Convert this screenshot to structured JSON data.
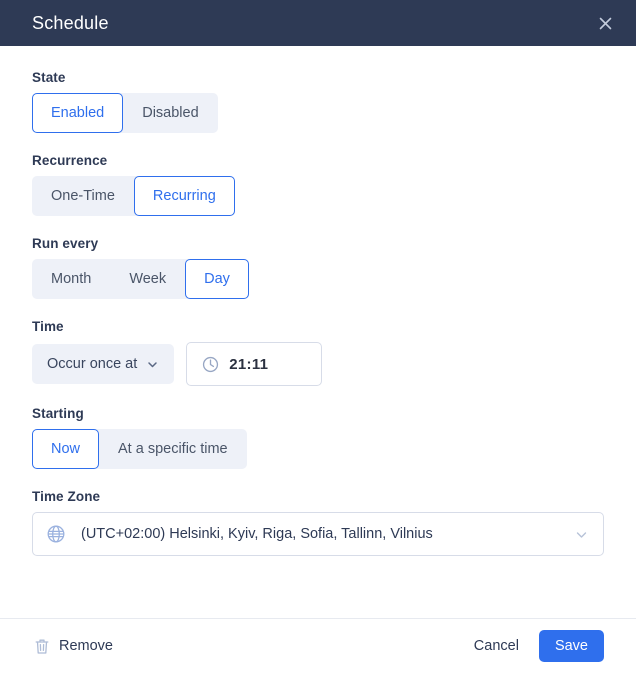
{
  "header": {
    "title": "Schedule",
    "close_icon": "close-icon",
    "background": "#2e3a55"
  },
  "colors": {
    "accent": "#2f6fed",
    "header_bg": "#2e3a55",
    "segment_bg": "#eef1f8",
    "label_text": "#2e3a55",
    "border": "#d7dce8"
  },
  "fields": {
    "state": {
      "label": "State",
      "options": [
        {
          "label": "Enabled",
          "selected": true
        },
        {
          "label": "Disabled",
          "selected": false
        }
      ]
    },
    "recurrence": {
      "label": "Recurrence",
      "options": [
        {
          "label": "One-Time",
          "selected": false
        },
        {
          "label": "Recurring",
          "selected": true
        }
      ]
    },
    "run_every": {
      "label": "Run every",
      "options": [
        {
          "label": "Month",
          "selected": false
        },
        {
          "label": "Week",
          "selected": false
        },
        {
          "label": "Day",
          "selected": true
        }
      ]
    },
    "time": {
      "label": "Time",
      "occur_select_value": "Occur once at",
      "occur_select_icon": "chevron-down-icon",
      "time_value": "21:11",
      "time_icon": "clock-icon"
    },
    "starting": {
      "label": "Starting",
      "options": [
        {
          "label": "Now",
          "selected": true
        },
        {
          "label": "At a specific time",
          "selected": false
        }
      ]
    },
    "time_zone": {
      "label": "Time Zone",
      "value": "(UTC+02:00) Helsinki, Kyiv, Riga, Sofia, Tallinn, Vilnius",
      "leading_icon": "globe-icon",
      "trailing_icon": "chevron-down-icon"
    }
  },
  "footer": {
    "remove_label": "Remove",
    "remove_icon": "trash-icon",
    "cancel_label": "Cancel",
    "save_label": "Save"
  }
}
